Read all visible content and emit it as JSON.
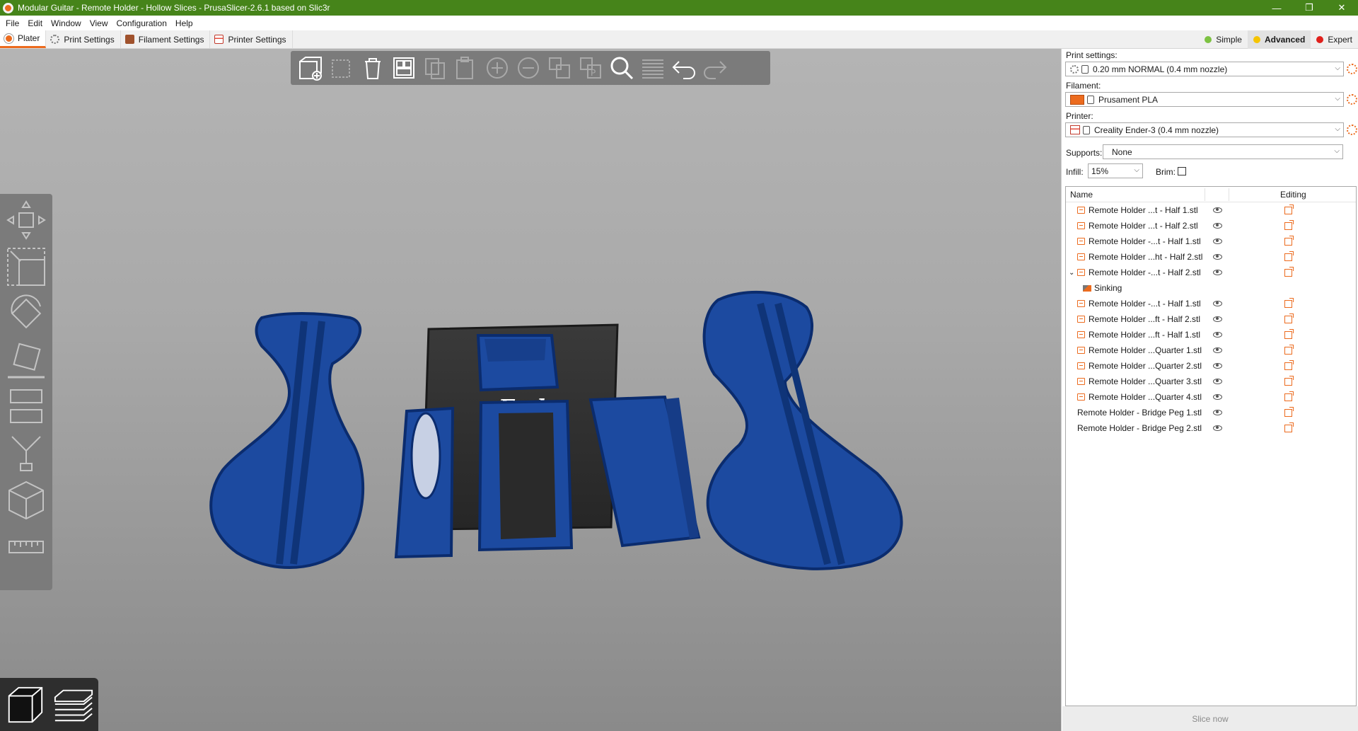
{
  "window": {
    "title": "Modular Guitar - Remote Holder - Hollow Slices - PrusaSlicer-2.6.1 based on Slic3r",
    "controls": [
      "—",
      "❐",
      "✕"
    ]
  },
  "menu": [
    "File",
    "Edit",
    "Window",
    "View",
    "Configuration",
    "Help"
  ],
  "tabs": [
    {
      "label": "Plater",
      "active": true
    },
    {
      "label": "Print Settings"
    },
    {
      "label": "Filament Settings"
    },
    {
      "label": "Printer Settings"
    }
  ],
  "modes": [
    {
      "label": "Simple",
      "color": "#7dc242"
    },
    {
      "label": "Advanced",
      "color": "#f5c400",
      "selected": true
    },
    {
      "label": "Expert",
      "color": "#e0201c"
    }
  ],
  "sidebar": {
    "print_settings_label": "Print settings:",
    "print_settings_value": "0.20 mm NORMAL (0.4 mm nozzle)",
    "filament_label": "Filament:",
    "filament_value": "Prusament PLA",
    "filament_color": "#ec6b1e",
    "printer_label": "Printer:",
    "printer_value": "Creality Ender-3 (0.4 mm nozzle)",
    "supports_label": "Supports:",
    "supports_value": "None",
    "infill_label": "Infill:",
    "infill_value": "15%",
    "brim_label": "Brim:",
    "brim_checked": false
  },
  "object_list": {
    "header_name": "Name",
    "header_editing": "Editing",
    "rows": [
      {
        "name": "Remote Holder ...t - Half 1.stl"
      },
      {
        "name": "Remote Holder ...t - Half 2.stl"
      },
      {
        "name": "Remote Holder -...t - Half 1.stl"
      },
      {
        "name": "Remote Holder ...ht - Half 2.stl"
      },
      {
        "name": "Remote Holder -...t - Half 2.stl",
        "expanded": true
      },
      {
        "name": "Sinking",
        "child": true
      },
      {
        "name": "Remote Holder -...t - Half 1.stl"
      },
      {
        "name": "Remote Holder ...ft - Half 2.stl"
      },
      {
        "name": "Remote Holder ...ft - Half 1.stl"
      },
      {
        "name": "Remote Holder ...Quarter 1.stl"
      },
      {
        "name": "Remote Holder ...Quarter 2.stl"
      },
      {
        "name": "Remote Holder ...Quarter 3.stl"
      },
      {
        "name": "Remote Holder ...Quarter 4.stl"
      },
      {
        "name": "Remote Holder - Bridge Peg 1.stl",
        "no_icon": true
      },
      {
        "name": "Remote Holder - Bridge Peg 2.stl",
        "no_icon": true
      }
    ]
  },
  "slice_button": "Slice now",
  "bed_logo": "Ende",
  "toolbar_icons": [
    "add-icon",
    "delete-icon",
    "delete-all-icon",
    "arrange-icon",
    "copy-icon",
    "paste-icon",
    "add-instance-icon",
    "remove-instance-icon",
    "split-objects-icon",
    "split-parts-icon",
    "search-icon",
    "layers-editing-icon",
    "undo-icon",
    "redo-icon"
  ],
  "left_toolbar_icons": [
    "move-icon",
    "scale-icon",
    "rotate-icon",
    "place-on-face-icon",
    "cut-icon",
    "paint-supports-icon",
    "measure-cube-icon",
    "ruler-icon"
  ],
  "colors": {
    "accent": "#ec6b1e",
    "titlebar": "#46841a",
    "model": "#1e4a9c"
  }
}
